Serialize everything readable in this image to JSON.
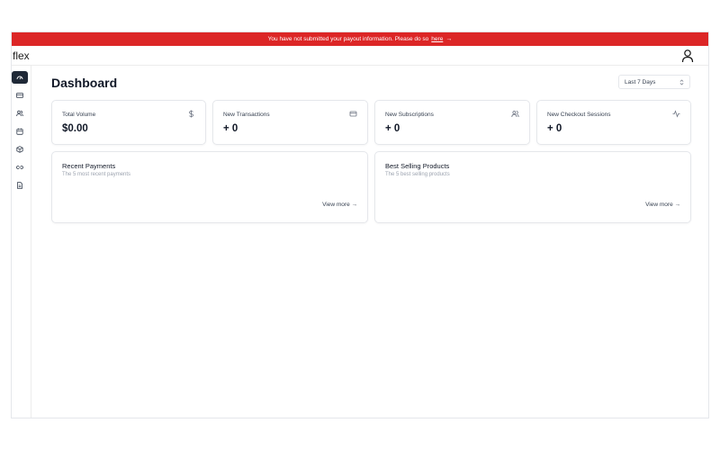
{
  "banner": {
    "message": "You have not submitted your payout information. Please do so",
    "link": "here",
    "arrow": "→"
  },
  "header": {
    "logo": "flex"
  },
  "sidebar": {
    "items": [
      {
        "icon": "gauge-icon",
        "active": true
      },
      {
        "icon": "credit-card-icon",
        "active": false
      },
      {
        "icon": "users-icon",
        "active": false
      },
      {
        "icon": "calendar-icon",
        "active": false
      },
      {
        "icon": "box-icon",
        "active": false
      },
      {
        "icon": "link-icon",
        "active": false
      },
      {
        "icon": "document-icon",
        "active": false
      }
    ]
  },
  "page": {
    "title": "Dashboard",
    "range": "Last 7 Days"
  },
  "stats": [
    {
      "title": "Total Volume",
      "value": "$0.00",
      "icon": "dollar-icon"
    },
    {
      "title": "New Transactions",
      "value": "+ 0",
      "icon": "credit-card-icon"
    },
    {
      "title": "New Subscriptions",
      "value": "+ 0",
      "icon": "users-icon"
    },
    {
      "title": "New Checkout Sessions",
      "value": "+ 0",
      "icon": "activity-icon"
    }
  ],
  "panels": [
    {
      "title": "Recent Payments",
      "subtitle": "The 5 most recent payments",
      "link": "View more →"
    },
    {
      "title": "Best Selling Products",
      "subtitle": "The 5 best selling products",
      "link": "View more →"
    }
  ],
  "colors": {
    "banner": "#dc2626",
    "active_nav": "#1f2937"
  }
}
